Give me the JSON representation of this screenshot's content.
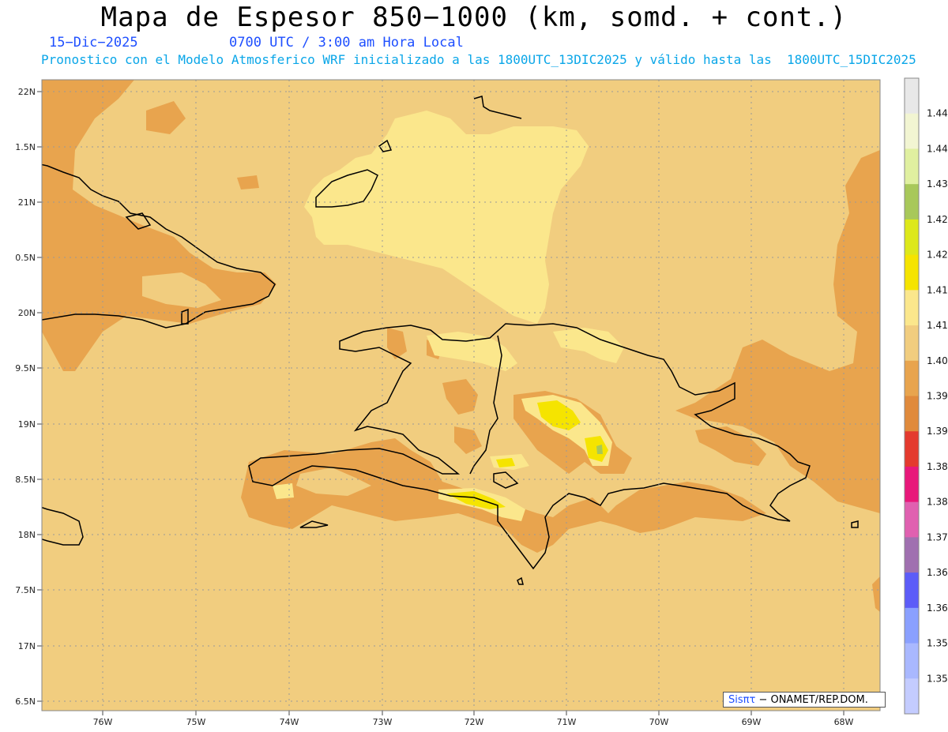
{
  "title": "Mapa de Espesor 850−1000 (km, somd. + cont.)",
  "date": "15−Dic−2025",
  "time": "0700 UTC / 3:00 am Hora Local",
  "subtitle": "Pronostico con el Modelo Atmosferico WRF inicializado a las 1800UTC_13DIC2025 y válido hasta las  1800UTC_15DIC2025",
  "credit": {
    "brand": "Sisπτ",
    "text": "− ONAMET/REP.DOM."
  },
  "lat_ticks": [
    "22N",
    "1.5N",
    "21N",
    "0.5N",
    "20N",
    "9.5N",
    "19N",
    "8.5N",
    "18N",
    "7.5N",
    "17N",
    "6.5N"
  ],
  "lon_ticks": [
    "76W",
    "75W",
    "74W",
    "73W",
    "72W",
    "71W",
    "70W",
    "69W",
    "68W"
  ],
  "colorbar": {
    "labels": [
      "1.446",
      "1.44",
      "1.434",
      "1.428",
      "1.422",
      "1.416",
      "1.41",
      "1.404",
      "1.398",
      "1.392",
      "1.386",
      "1.38",
      "1.374",
      "1.368",
      "1.362",
      "1.356",
      "1.35"
    ],
    "colors": [
      "#e8e8e8",
      "#f2f5d2",
      "#e0f0a0",
      "#a8c85a",
      "#dde81a",
      "#f5e400",
      "#fbe78c",
      "#f1cd7f",
      "#e8a44e",
      "#e08a3c",
      "#e43a2e",
      "#e8187a",
      "#e060b0",
      "#a070b0",
      "#5c5cf8",
      "#8aa0ff",
      "#a9b8ff",
      "#c4ccff"
    ]
  },
  "fills": {
    "base": "#f1cd7f",
    "warm": "#e8a44e",
    "light": "#fbe78c",
    "yellow": "#f5e400",
    "green": "#a8c85a"
  }
}
